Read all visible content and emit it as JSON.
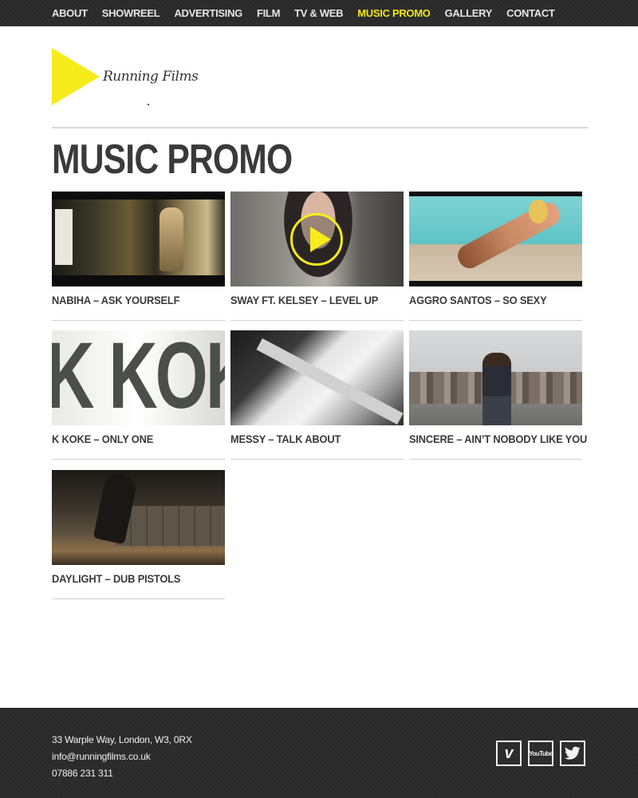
{
  "nav": {
    "items": [
      {
        "label": "ABOUT",
        "active": false
      },
      {
        "label": "SHOWREEL",
        "active": false
      },
      {
        "label": "ADVERTISING",
        "active": false
      },
      {
        "label": "FILM",
        "active": false
      },
      {
        "label": "TV & WEB",
        "active": false
      },
      {
        "label": "MUSIC PROMO",
        "active": true
      },
      {
        "label": "GALLERY",
        "active": false
      },
      {
        "label": "CONTACT",
        "active": false
      }
    ]
  },
  "logo": {
    "wordmark": "Running Films",
    "accent_color": "#f6ec1c"
  },
  "page": {
    "title": "MUSIC PROMO"
  },
  "videos": [
    {
      "title": "NABIHA – ASK YOURSELF",
      "thumb_icon": "video-thumbnail"
    },
    {
      "title": "SWAY FT. KELSEY – LEVEL UP",
      "thumb_icon": "play-icon"
    },
    {
      "title": "AGGRO SANTOS – SO SEXY",
      "thumb_icon": "video-thumbnail"
    },
    {
      "title": "K KOKE – ONLY ONE",
      "thumb_text": "K KOKE"
    },
    {
      "title": "MESSY – TALK ABOUT",
      "thumb_icon": "video-thumbnail"
    },
    {
      "title": "SINCERE – AIN’T NOBODY LIKE YOU",
      "thumb_icon": "video-thumbnail"
    },
    {
      "title": "DAYLIGHT – DUB PISTOLS",
      "thumb_icon": "video-thumbnail"
    }
  ],
  "footer": {
    "address": "33 Warple Way, London, W3, 0RX",
    "email": "info@runningfilms.co.uk",
    "phone": "07886 231 311",
    "social": [
      {
        "name": "vimeo-icon",
        "glyph": "v"
      },
      {
        "name": "youtube-icon",
        "glyph": "YouTube"
      },
      {
        "name": "twitter-icon"
      }
    ]
  },
  "colors": {
    "nav_bg": "#2b2b2b",
    "nav_text": "#e6e6e6",
    "active": "#f4e519",
    "heading": "#3a3a3a"
  }
}
